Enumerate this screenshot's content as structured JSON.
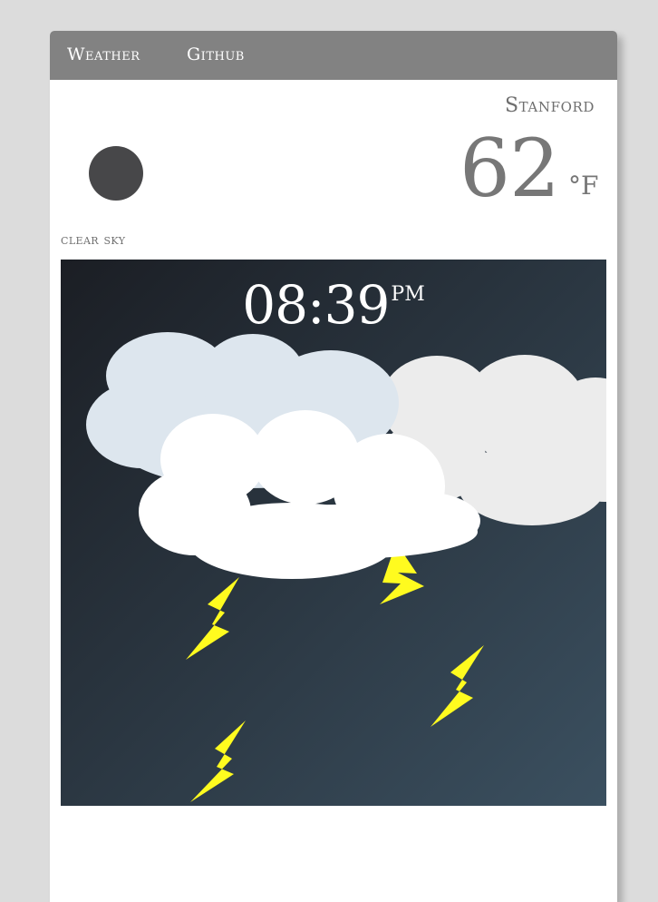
{
  "nav": {
    "weather_label": "Weather",
    "github_label": "Github"
  },
  "location": {
    "city": "Stanford"
  },
  "current": {
    "icon": "dark-circle-icon",
    "temperature": "62",
    "unit": "°F",
    "description": "clear sky"
  },
  "scene": {
    "condition": "thunderstorm",
    "time": "08:39",
    "ampm": "PM",
    "colors": {
      "sky_top": "#1b1e24",
      "sky_bottom": "#3b5060",
      "cloud_back_left": "#dde6ee",
      "cloud_back_right": "#ececec",
      "cloud_front": "#ffffff",
      "lightning": "#fffb1f"
    }
  }
}
